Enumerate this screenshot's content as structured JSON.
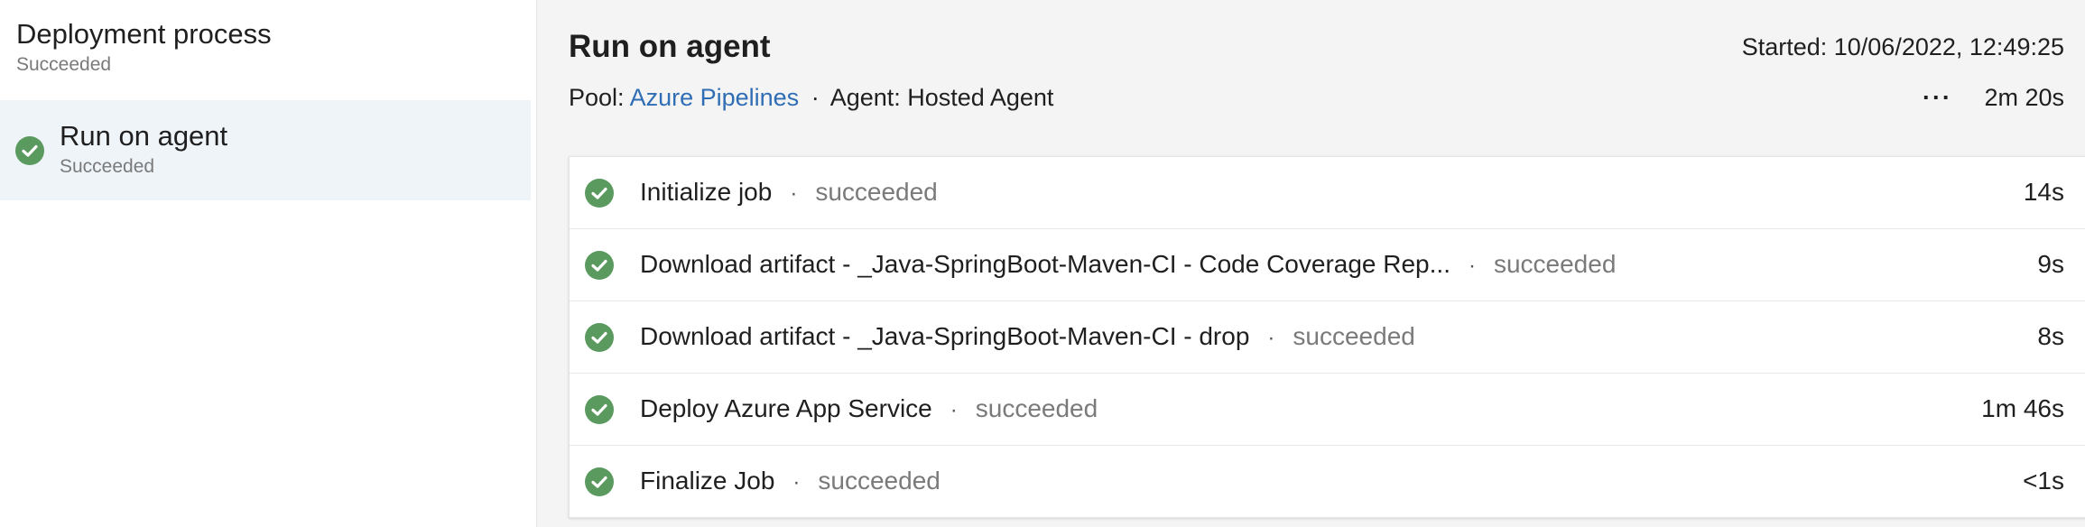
{
  "colors": {
    "success": "#5b9a5f",
    "link": "#2f6db5",
    "selected_bg": "#eff4f9",
    "pane_bg": "#f4f4f4"
  },
  "left_pane": {
    "title": "Deployment process",
    "status": "Succeeded",
    "stage": {
      "title": "Run on agent",
      "status": "Succeeded",
      "icon": "check-circle-icon"
    }
  },
  "job": {
    "title": "Run on agent",
    "started": "Started: 10/06/2022, 12:49:25",
    "pool_label": "Pool:",
    "pool_name": "Azure Pipelines",
    "separator": "·",
    "agent": "Agent: Hosted Agent",
    "more_label": "···",
    "duration": "2m 20s"
  },
  "steps": [
    {
      "name": "Initialize job",
      "status": "succeeded",
      "duration": "14s",
      "icon": "check-circle-icon"
    },
    {
      "name": "Download artifact - _Java-SpringBoot-Maven-CI - Code Coverage Rep...",
      "status": "succeeded",
      "duration": "9s",
      "icon": "check-circle-icon"
    },
    {
      "name": "Download artifact - _Java-SpringBoot-Maven-CI - drop",
      "status": "succeeded",
      "duration": "8s",
      "icon": "check-circle-icon"
    },
    {
      "name": "Deploy Azure App Service",
      "status": "succeeded",
      "duration": "1m 46s",
      "icon": "check-circle-icon"
    },
    {
      "name": "Finalize Job",
      "status": "succeeded",
      "duration": "<1s",
      "icon": "check-circle-icon"
    }
  ]
}
